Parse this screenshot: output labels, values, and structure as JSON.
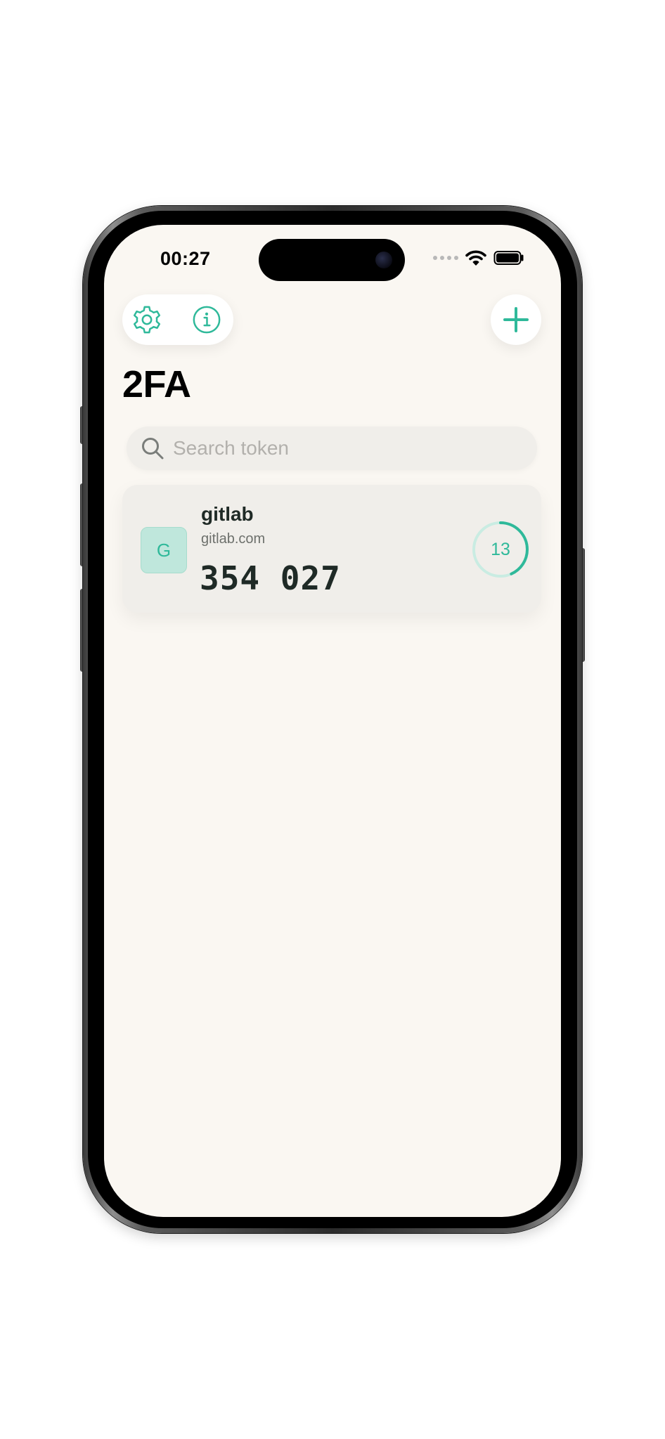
{
  "status_bar": {
    "time": "00:27"
  },
  "app": {
    "title": "2FA"
  },
  "search": {
    "placeholder": "Search token",
    "value": ""
  },
  "tokens": [
    {
      "initial": "G",
      "name": "gitlab",
      "issuer": "gitlab.com",
      "code": "354 027",
      "seconds_remaining": "13",
      "period_seconds": 30
    }
  ],
  "icons": {
    "settings": "gear-icon",
    "info": "info-icon",
    "add": "plus-icon",
    "search": "search-icon"
  },
  "colors": {
    "accent": "#2fb99a",
    "accent_light": "#bfe7dc",
    "background": "#faf7f2",
    "card": "#f0eeea",
    "text": "#1f2a26"
  }
}
